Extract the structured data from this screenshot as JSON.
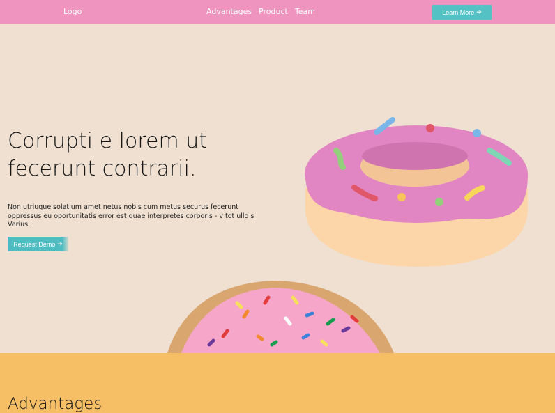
{
  "nav": {
    "logo": "Logo",
    "links": [
      "Advantages",
      "Product",
      "Team"
    ],
    "cta_label": "Learn More"
  },
  "hero": {
    "title": "Corrupti e lorem ut fecerunt contrarii.",
    "text": "Non utriuque solatium amet netus nobis cum metus securus fecerunt oppressus eu oportunitatis error est quae interpretes corporis - v tot ullo s Verius.",
    "button_label": "Request Demo"
  },
  "advantages": {
    "heading": "Advantages"
  },
  "colors": {
    "navbar": "#ef94bf",
    "page_bg": "#efe0d2",
    "accent_teal": "#54c1c4",
    "section_yellow": "#f6bf66",
    "donut_icing": "#e186c2",
    "donut_dough": "#fcd6a8"
  },
  "icons": [
    "arrow-right-icon",
    "donut-illustration",
    "donut-photo"
  ]
}
